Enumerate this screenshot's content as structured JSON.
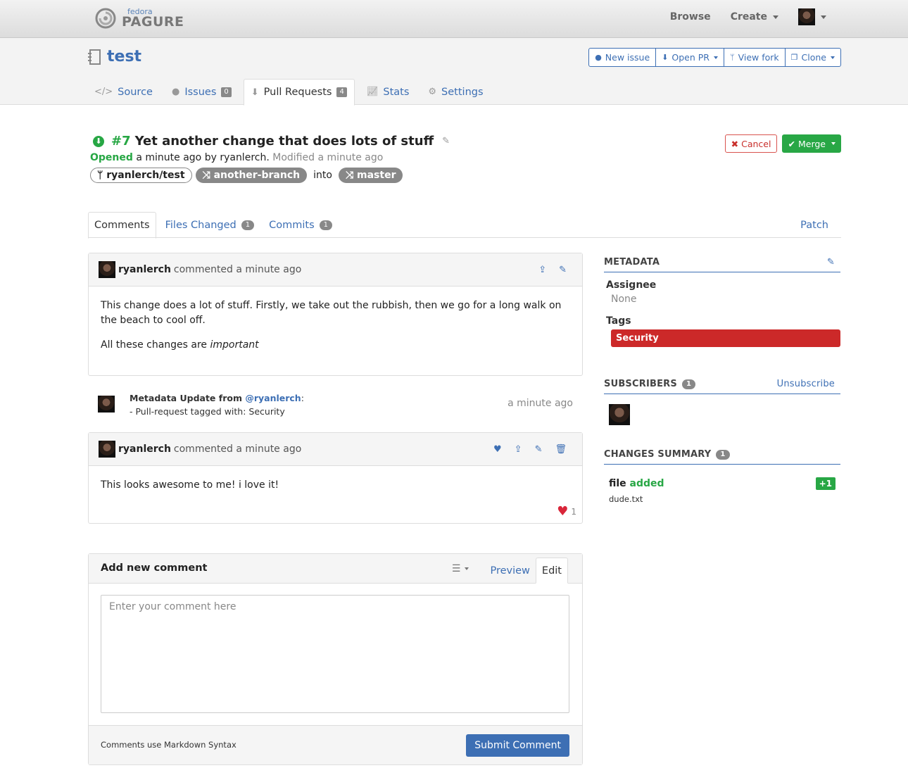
{
  "topbar": {
    "logo_small": "fedora",
    "logo_big": "PAGURE",
    "browse": "Browse",
    "create": "Create"
  },
  "repo": {
    "name": "test",
    "actions": {
      "new_issue": "New issue",
      "open_pr": "Open PR",
      "view_fork": "View fork",
      "clone": "Clone"
    },
    "tabs": [
      {
        "label": "Source"
      },
      {
        "label": "Issues",
        "count": "0"
      },
      {
        "label": "Pull Requests",
        "count": "4"
      },
      {
        "label": "Stats"
      },
      {
        "label": "Settings"
      }
    ]
  },
  "pr": {
    "number": "#7",
    "title": "Yet another change that does lots of stuff",
    "status": "Opened",
    "opened_text": "a minute ago by ryanlerch.",
    "modified_text": "Modified a minute ago",
    "from_repo": "ryanlerch/test",
    "from_branch": "another-branch",
    "into": "into",
    "to_branch": "master",
    "cancel": "Cancel",
    "merge": "Merge"
  },
  "pr_tabs": {
    "comments": "Comments",
    "files_changed": "Files Changed",
    "files_count": "1",
    "commits": "Commits",
    "commits_count": "1",
    "patch": "Patch"
  },
  "comments": [
    {
      "user": "ryanlerch",
      "when": "commented a minute ago",
      "para1": "This change does a lot of stuff. Firstly, we take out the rubbish, then we go for a long walk on the beach to cool off.",
      "para2_prefix": "All these changes are ",
      "para2_em": "important"
    },
    {
      "user": "ryanlerch",
      "when": "commented a minute ago",
      "text": "This looks awesome to me! i love it!",
      "reactions": "1"
    }
  ],
  "metadata_update": {
    "title_prefix": "Metadata Update from ",
    "user": "@ryanlerch",
    "colon": ":",
    "detail": "- Pull-request tagged with: Security",
    "time": "a minute ago"
  },
  "sidebar": {
    "metadata_title": "METADATA",
    "assignee_label": "Assignee",
    "assignee_value": "None",
    "tags_label": "Tags",
    "tag": "Security",
    "tag_color": "#cc2929",
    "subscribers_title": "SUBSCRIBERS",
    "subscribers_count": "1",
    "unsubscribe": "Unsubscribe",
    "changes_title": "CHANGES SUMMARY",
    "changes_count": "1",
    "file_label": "file",
    "file_status": "added",
    "file_delta": "+1",
    "file_name": "dude.txt"
  },
  "new_comment": {
    "title": "Add new comment",
    "preview": "Preview",
    "edit": "Edit",
    "placeholder": "Enter your comment here",
    "hint": "Comments use Markdown Syntax",
    "submit": "Submit Comment"
  }
}
